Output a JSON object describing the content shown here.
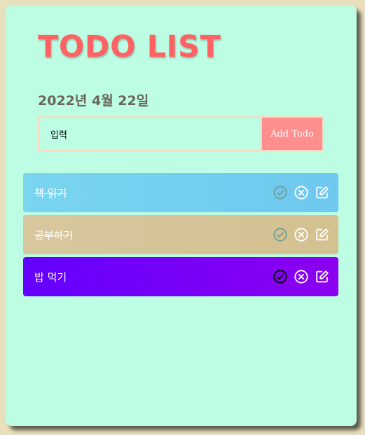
{
  "header": {
    "title": "TODO LIST",
    "date": "2022년 4월 22일"
  },
  "form": {
    "input_value": "입력",
    "add_label": "Add Todo"
  },
  "todos": [
    {
      "text": "책 읽기",
      "done": true
    },
    {
      "text": "공부하기",
      "done": true
    },
    {
      "text": "밥 먹기",
      "done": false
    }
  ],
  "colors": {
    "page_bg": "#e8dfbd",
    "card_bg": "#bdfde4",
    "title": "#ff6263",
    "add_button": "#ff8f8e",
    "item_1": "#7ad5ef",
    "item_2": "#d8c69f",
    "item_3": "#6300ff"
  },
  "icons": [
    "check-circle-icon",
    "x-circle-icon",
    "edit-icon"
  ]
}
